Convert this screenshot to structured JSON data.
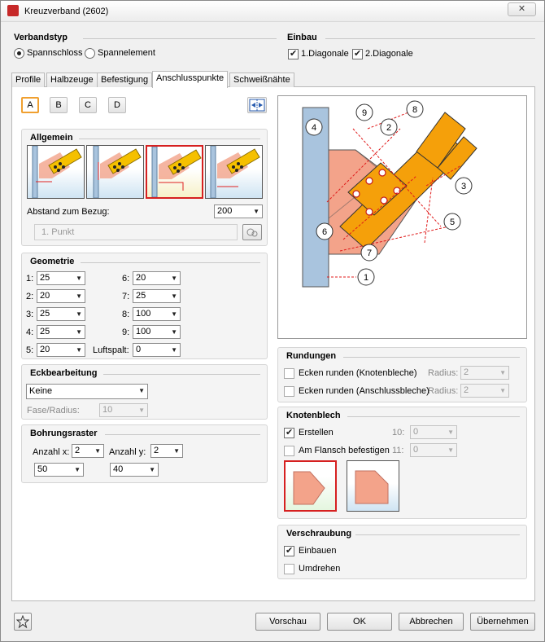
{
  "window": {
    "title": "Kreuzverband (2602)",
    "close_label": "✕"
  },
  "verbandstyp": {
    "title": "Verbandstyp",
    "options": [
      "Spannschloss",
      "Spannelement"
    ],
    "selected": "Spannschloss"
  },
  "einbau": {
    "title": "Einbau",
    "items": [
      {
        "label": "1.Diagonale",
        "checked": true
      },
      {
        "label": "2.Diagonale",
        "checked": true
      }
    ]
  },
  "tabs": [
    "Profile",
    "Halbzeuge",
    "Befestigung",
    "Anschlusspunkte",
    "Schweißnähte"
  ],
  "active_tab": "Anschlusspunkte",
  "points": {
    "labels": [
      "A",
      "B",
      "C",
      "D"
    ],
    "selected": "A"
  },
  "allgemein": {
    "title": "Allgemein",
    "abstand_label": "Abstand zum Bezug:",
    "abstand_value": "200",
    "punkt_placeholder": "1. Punkt",
    "selected_thumb": 3
  },
  "geometrie": {
    "title": "Geometrie",
    "left": [
      {
        "label": "1:",
        "value": "25"
      },
      {
        "label": "2:",
        "value": "20"
      },
      {
        "label": "3:",
        "value": "25"
      },
      {
        "label": "4:",
        "value": "25"
      },
      {
        "label": "5:",
        "value": "20"
      }
    ],
    "right": [
      {
        "label": "6:",
        "value": "20"
      },
      {
        "label": "7:",
        "value": "25"
      },
      {
        "label": "8:",
        "value": "100"
      },
      {
        "label": "9:",
        "value": "100"
      },
      {
        "label": "Luftspalt:",
        "value": "0"
      }
    ]
  },
  "eckbearbeitung": {
    "title": "Eckbearbeitung",
    "value": "Keine",
    "fase_label": "Fase/Radius:",
    "fase_value": "10"
  },
  "bohrungsraster": {
    "title": "Bohrungsraster",
    "anzahl_x_label": "Anzahl x:",
    "anzahl_x": "2",
    "anzahl_y_label": "Anzahl y:",
    "anzahl_y": "2",
    "abstand_x": "50",
    "abstand_y": "40"
  },
  "rundungen": {
    "title": "Rundungen",
    "items": [
      {
        "label": "Ecken runden (Knotenbleche)",
        "radius_label": "Radius:",
        "radius": "2"
      },
      {
        "label": "Ecken runden (Anschlussbleche)",
        "radius_label": "Radius:",
        "radius": "2"
      }
    ]
  },
  "knotenblech": {
    "title": "Knotenblech",
    "erstellen": {
      "label": "Erstellen",
      "checked": true,
      "num_label": "10:",
      "num_value": "0"
    },
    "flansch": {
      "label": "Am Flansch befestigen",
      "checked": false,
      "num_label": "11:",
      "num_value": "0"
    }
  },
  "verschraubung": {
    "title": "Verschraubung",
    "items": [
      {
        "label": "Einbauen",
        "checked": true
      },
      {
        "label": "Umdrehen",
        "checked": false
      }
    ]
  },
  "diagram": {
    "callouts": [
      "1",
      "2",
      "3",
      "4",
      "5",
      "6",
      "7",
      "8",
      "9"
    ]
  },
  "buttons": {
    "vorschau": "Vorschau",
    "ok": "OK",
    "abbrechen": "Abbrechen",
    "uebernehmen": "Übernehmen"
  },
  "colors": {
    "accent": "#f0a030",
    "selected_border": "#d62020",
    "plate": "#f3a38a",
    "profile": "#f5a00a",
    "column": "#a9c4de"
  }
}
